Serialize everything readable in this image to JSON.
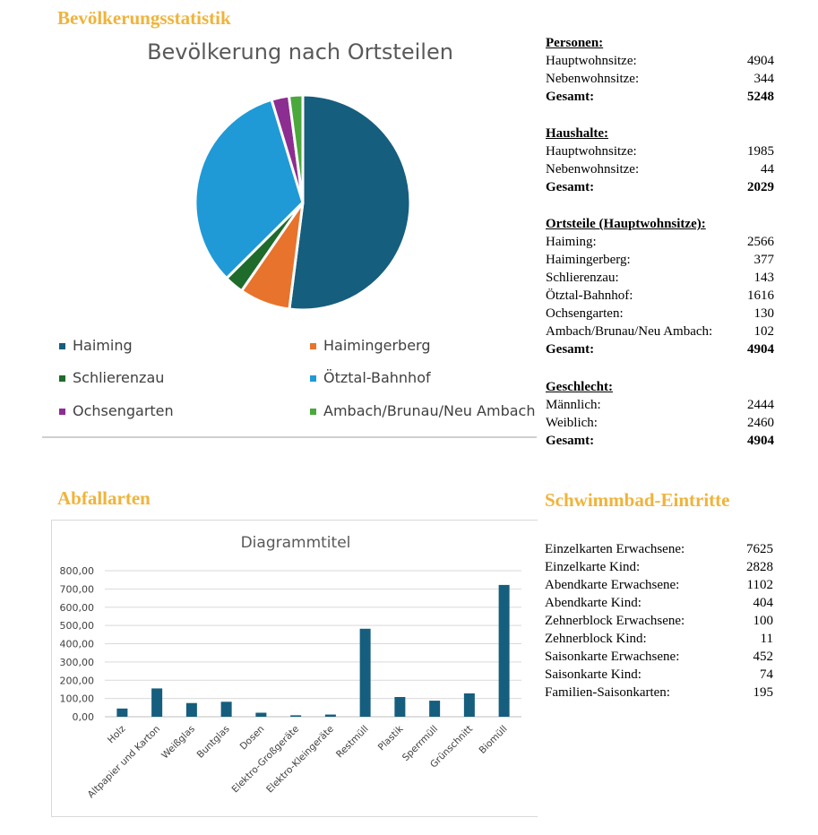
{
  "sections": {
    "population_title": "Bevölkerungsstatistik",
    "waste_title": "Abfallarten",
    "pool_title": "Schwimmbad-Eintritte"
  },
  "chart_data": [
    {
      "type": "pie",
      "title": "Bevölkerung nach Ortsteilen",
      "categories": [
        "Haiming",
        "Haimingerberg",
        "Schlierenzau",
        "Ötztal-Bahnhof",
        "Ochsengarten",
        "Ambach/Brunau/Neu Ambach"
      ],
      "values": [
        2566,
        377,
        143,
        1616,
        130,
        102
      ],
      "colors": [
        "#165e7e",
        "#e8732c",
        "#1e6b2b",
        "#1f9ad6",
        "#8c2d91",
        "#4aa83c"
      ],
      "legend_position": "bottom"
    },
    {
      "type": "bar",
      "title": "Diagrammtitel",
      "categories": [
        "Holz",
        "Altpapier und Karton",
        "Weißglas",
        "Buntglas",
        "Dosen",
        "Elektro-Großgeräte",
        "Elektro-Kleingeräte",
        "Restmüll",
        "Plastik",
        "Sperrmüll",
        "Grünschnitt",
        "Biomüll"
      ],
      "values": [
        45,
        155,
        75,
        82,
        22,
        8,
        12,
        482,
        108,
        88,
        128,
        722
      ],
      "ylim": [
        0,
        800
      ],
      "yticks": [
        "0,00",
        "100,00",
        "200,00",
        "300,00",
        "400,00",
        "500,00",
        "600,00",
        "700,00",
        "800,00"
      ],
      "color": "#165e7e",
      "grid": true,
      "legend": false
    }
  ],
  "stats": {
    "personen": {
      "heading": "Personen:",
      "rows": [
        {
          "label": "Hauptwohnsitze:",
          "value": "4904"
        },
        {
          "label": "Nebenwohnsitze:",
          "value": "344"
        }
      ],
      "total": {
        "label": "Gesamt:",
        "value": "5248"
      }
    },
    "haushalte": {
      "heading": "Haushalte:",
      "rows": [
        {
          "label": "Hauptwohnsitze:",
          "value": "1985"
        },
        {
          "label": "Nebenwohnsitze:",
          "value": "44"
        }
      ],
      "total": {
        "label": "Gesamt:",
        "value": "2029"
      }
    },
    "ortsteile": {
      "heading": "Ortsteile (Hauptwohnsitze):",
      "rows": [
        {
          "label": "Haiming:",
          "value": "2566"
        },
        {
          "label": "Haimingerberg:",
          "value": "377"
        },
        {
          "label": "Schlierenzau:",
          "value": "143"
        },
        {
          "label": "Ötztal-Bahnhof:",
          "value": "1616"
        },
        {
          "label": "Ochsengarten:",
          "value": "130"
        },
        {
          "label": "Ambach/Brunau/Neu Ambach:",
          "value": "102"
        }
      ],
      "total": {
        "label": "Gesamt:",
        "value": "4904"
      }
    },
    "geschlecht": {
      "heading": "Geschlecht:",
      "rows": [
        {
          "label": "Männlich:",
          "value": "2444"
        },
        {
          "label": "Weiblich:",
          "value": "2460"
        }
      ],
      "total": {
        "label": "Gesamt:",
        "value": "4904"
      }
    },
    "schwimmbad": {
      "rows": [
        {
          "label": "Einzelkarten Erwachsene:",
          "value": "7625"
        },
        {
          "label": "Einzelkarte Kind:",
          "value": "2828"
        },
        {
          "label": "Abendkarte Erwachsene:",
          "value": "1102"
        },
        {
          "label": "Abendkarte Kind:",
          "value": "404"
        },
        {
          "label": "Zehnerblock Erwachsene:",
          "value": "100"
        },
        {
          "label": "Zehnerblock Kind:",
          "value": "11"
        },
        {
          "label": "Saisonkarte Erwachsene:",
          "value": "452"
        },
        {
          "label": "Saisonkarte Kind:",
          "value": "74"
        },
        {
          "label": "Familien-Saisonkarten:",
          "value": "195"
        }
      ]
    }
  }
}
